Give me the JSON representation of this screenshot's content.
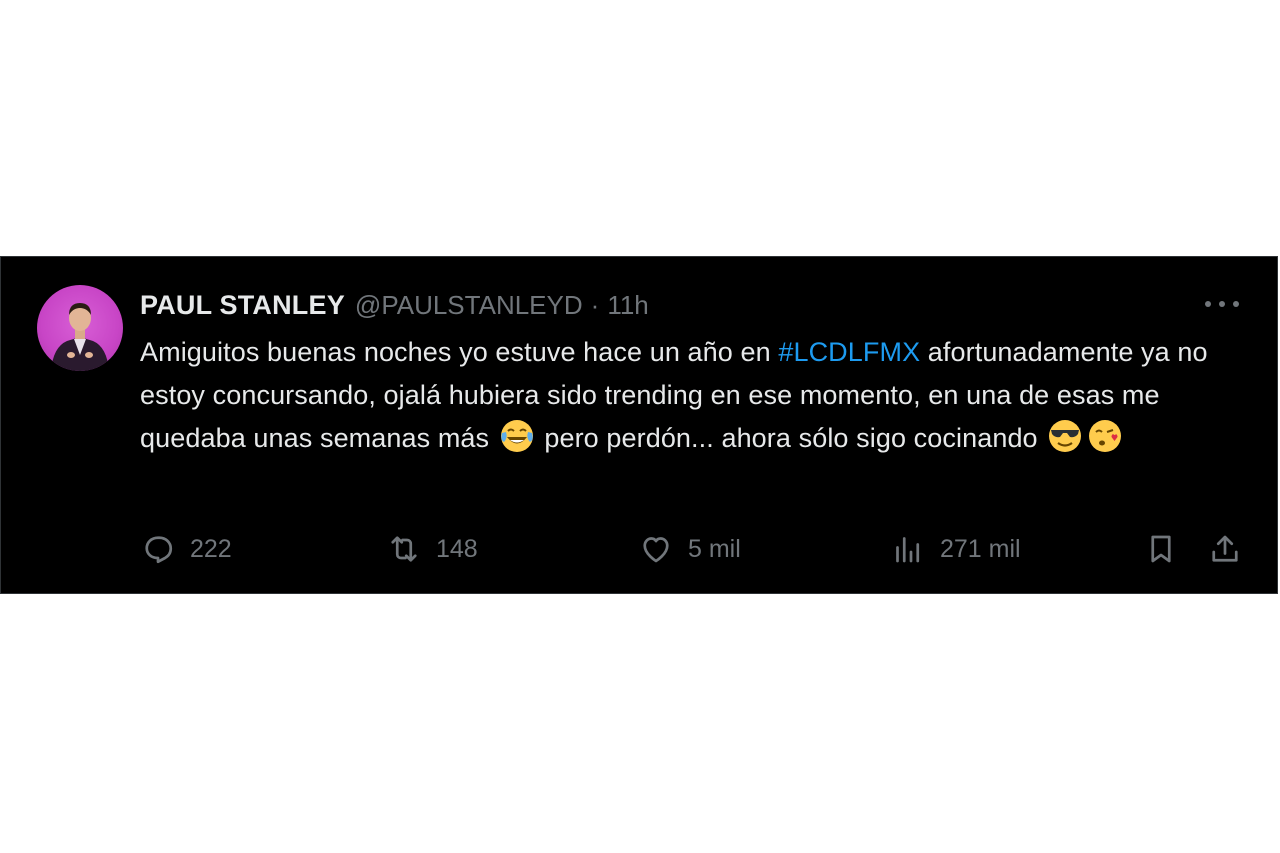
{
  "tweet": {
    "author_name": "PAUL STANLEY",
    "handle": "@PAULSTANLEYD",
    "separator": "·",
    "time": "11h",
    "text_part1": "Amiguitos buenas noches yo estuve hace un año en ",
    "hashtag": "#LCDLFMX",
    "text_part2": " afortunadamente ya no estoy concursando, ojalá hubiera sido trending en ese momento, en una de esas me quedaba unas semanas más ",
    "text_part3": " pero perdón... ahora sólo sigo cocinando ",
    "emojis": [
      "face-with-tears-of-joy",
      "smiling-face-with-sunglasses",
      "face-blowing-a-kiss"
    ]
  },
  "actions": {
    "replies": "222",
    "retweets": "148",
    "likes": "5 mil",
    "views": "271 mil"
  },
  "colors": {
    "background": "#000000",
    "text": "#e7e9ea",
    "muted": "#71767b",
    "link": "#1d9bf0",
    "avatar_bg": "#c845c6"
  }
}
